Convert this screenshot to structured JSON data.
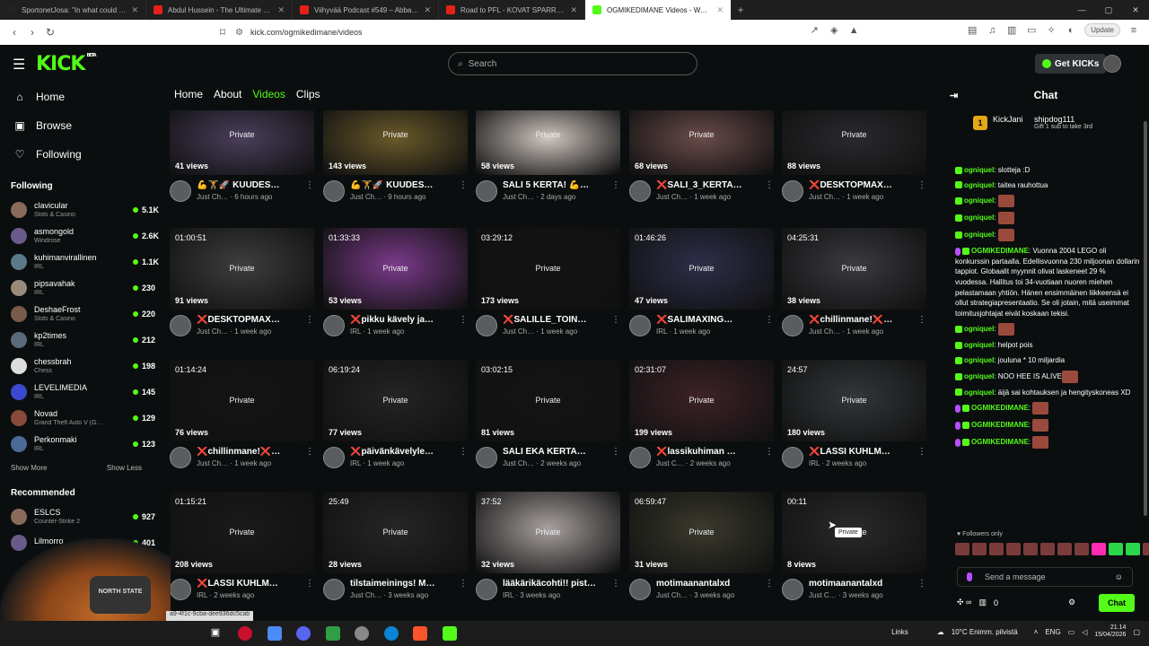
{
  "browser": {
    "tabs": [
      {
        "label": "SportonetJosa: \"In what could be fi…",
        "color": "#222"
      },
      {
        "label": "Abdul Hussein - The Ultimate Fighter",
        "color": "#e62117"
      },
      {
        "label": "Viihyvää Podcast #549 – Abba TUF…",
        "color": "#e62117"
      },
      {
        "label": "Road to PFL - KOVAT SPARRIT - You…",
        "color": "#e62117"
      },
      {
        "label": "OGMIKEDIMANE Videos - Watch…",
        "color": "#53fc18"
      }
    ],
    "url": "kick.com/ogmikedimane/videos",
    "update_label": "Update",
    "new_tab": "+"
  },
  "header": {
    "logo": "KICK",
    "logo_beta": "BETA",
    "search_placeholder": "Search",
    "get_kicks": "Get KICKs"
  },
  "sidebar": {
    "nav": [
      {
        "label": "Home",
        "icon": "home-icon",
        "glyph": "⌂"
      },
      {
        "label": "Browse",
        "icon": "browse-icon",
        "glyph": "▣"
      },
      {
        "label": "Following",
        "icon": "heart-icon",
        "glyph": "♡"
      }
    ],
    "following_title": "Following",
    "following": [
      {
        "name": "clavicular",
        "category": "Slots & Casino",
        "viewers": "5.1K"
      },
      {
        "name": "asmongold",
        "category": "Windrose",
        "viewers": "2.6K"
      },
      {
        "name": "kuhimanvirallinen",
        "category": "IRL",
        "viewers": "1.1K"
      },
      {
        "name": "pipsavahak",
        "category": "IRL",
        "viewers": "230"
      },
      {
        "name": "DeshaeFrost",
        "category": "Slots & Casino",
        "viewers": "220"
      },
      {
        "name": "kp2times",
        "category": "IRL",
        "viewers": "212"
      },
      {
        "name": "chessbrah",
        "category": "Chess",
        "viewers": "198"
      },
      {
        "name": "LEVELIMEDIA",
        "category": "IRL",
        "viewers": "145"
      },
      {
        "name": "Novad",
        "category": "Grand Theft Auto V (G…",
        "viewers": "129"
      },
      {
        "name": "Perkonmaki",
        "category": "IRL",
        "viewers": "123"
      }
    ],
    "show_more": "Show More",
    "show_less": "Show Less",
    "recommended_title": "Recommended",
    "recommended": [
      {
        "name": "ESLCS",
        "category": "Counter-Strike 2",
        "viewers": "927"
      },
      {
        "name": "Lilmorro",
        "category": "",
        "viewers": "401"
      }
    ]
  },
  "main": {
    "tabs": [
      {
        "label": "Home",
        "active": false
      },
      {
        "label": "About",
        "active": false
      },
      {
        "label": "Videos",
        "active": true
      },
      {
        "label": "Clips",
        "active": false
      }
    ],
    "private_label": "Private",
    "videos": [
      {
        "duration": "",
        "views": "41 views",
        "title": "💪🏋️🚀 KUUDES…",
        "sub": "Just Ch… · 6 hours ago",
        "color": "#4a3f5c"
      },
      {
        "duration": "",
        "views": "143 views",
        "title": "💪🏋️🚀 KUUDES…",
        "sub": "Just Ch… · 9 hours ago",
        "color": "#6a5a2a"
      },
      {
        "duration": "",
        "views": "58 views",
        "title": "SALI 5 KERTA! 💪…",
        "sub": "Just Ch… · 2 days ago",
        "color": "#cfc6c0"
      },
      {
        "duration": "",
        "views": "68 views",
        "title": "❌SALI_3_KERTA…",
        "sub": "Just Ch… · 1 week ago",
        "color": "#6b4b4b"
      },
      {
        "duration": "",
        "views": "88 views",
        "title": "❌DESKTOPMAX…",
        "sub": "Just Ch… · 1 week ago",
        "color": "#2a2a2e"
      },
      {
        "duration": "01:00:51",
        "views": "91 views",
        "title": "❌DESKTOPMAX…",
        "sub": "Just Ch… · 1 week ago",
        "color": "#3e3e3e"
      },
      {
        "duration": "01:33:33",
        "views": "53 views",
        "title": "❌pikku kävely ja…",
        "sub": "IRL · 1 week ago",
        "color": "#7a3a8a"
      },
      {
        "duration": "03:29:12",
        "views": "173 views",
        "title": "❌SALILLE_TOIN…",
        "sub": "Just Ch… · 1 week ago",
        "color": "#121212"
      },
      {
        "duration": "01:46:26",
        "views": "47 views",
        "title": "❌SALIMAXING…",
        "sub": "IRL · 1 week ago",
        "color": "#2e2e4a"
      },
      {
        "duration": "04:25:31",
        "views": "38 views",
        "title": "❌chillinmane!❌…",
        "sub": "Just Ch… · 1 week ago",
        "color": "#3a3a40"
      },
      {
        "duration": "01:14:24",
        "views": "76 views",
        "title": "❌chillinmane!❌…",
        "sub": "Just Ch… · 1 week ago",
        "color": "#141414"
      },
      {
        "duration": "06:19:24",
        "views": "77 views",
        "title": "❌päivänkävelyle…",
        "sub": "IRL · 1 week ago",
        "color": "#242424"
      },
      {
        "duration": "03:02:15",
        "views": "81 views",
        "title": "SALI EKA KERTA…",
        "sub": "Just Ch… · 2 weeks ago",
        "color": "#141414"
      },
      {
        "duration": "02:31:07",
        "views": "199 views",
        "title": "❌lassikuhiman …",
        "sub": "Just C… · 2 weeks ago",
        "color": "#3e2228"
      },
      {
        "duration": "24:57",
        "views": "180 views",
        "title": "❌LASSI KUHLM…",
        "sub": "IRL · 2 weeks ago",
        "color": "#33373a"
      },
      {
        "duration": "01:15:21",
        "views": "208 views",
        "title": "❌LASSI KUHLM…",
        "sub": "IRL · 2 weeks ago",
        "color": "#1a1a1a"
      },
      {
        "duration": "25:49",
        "views": "28 views",
        "title": "tilstaimeinings! M…",
        "sub": "Just Ch… · 3 weeks ago",
        "color": "#262626"
      },
      {
        "duration": "37:52",
        "views": "32 views",
        "title": "lääkärikäcohti!! pist…",
        "sub": "IRL · 3 weeks ago",
        "color": "#a8a0a0"
      },
      {
        "duration": "06:59:47",
        "views": "31 views",
        "title": "motimaanantalxd",
        "sub": "Just Ch… · 3 weeks ago",
        "color": "#3a3a2e"
      },
      {
        "duration": "00:11",
        "views": "8 views",
        "title": "motimaanantalxd",
        "sub": "Just C… · 3 weeks ago",
        "color": "#2a2a2a"
      }
    ],
    "tooltip": "Private"
  },
  "chat": {
    "title": "Chat",
    "pinned_user1": "KickJani",
    "pinned_user2": "shipdog111",
    "pinned_medal": "1",
    "pinned_gift": "Gift 1 sub to take 3rd",
    "messages": [
      {
        "user": "ogniquel",
        "text": "slotteja :D",
        "emote": false
      },
      {
        "user": "ogniquel",
        "text": "taitea rauhottua",
        "emote": false
      },
      {
        "user": "ogniquel",
        "text": "",
        "emote": true
      },
      {
        "user": "ogniquel",
        "text": "",
        "emote": true
      },
      {
        "user": "ogniquel",
        "text": "",
        "emote": true
      },
      {
        "user": "OGMIKEDIMANE",
        "text": "Vuonna 2004 LEGO oli konkurssin partaalla. Edellisvuonna 230 miljoonan dollarin tappiot. Globaalit myynnit olivat laskeneet 29 % vuodessa. Hallitus toi 34-vuotiaan nuoren miehen pelastamaan yhtiön. Hänen ensimmäinen liikkeensä ei ollut strategiapresentaatio. Se oli jotain, mitä useimmat toimitusjohtajat eivät koskaan tekisi.",
        "emote": false
      },
      {
        "user": "ogniquel",
        "text": "",
        "emote": true
      },
      {
        "user": "ogniquel",
        "text": "helpot pois",
        "emote": false
      },
      {
        "user": "ogniquel",
        "text": "jouluna * 10 miljardia",
        "emote": false
      },
      {
        "user": "ogniquel",
        "text": "NOO HEE IS ALIVE",
        "emote": true
      },
      {
        "user": "ogniquel",
        "text": "äijä sai kohtauksen ja hengityskoneas XD",
        "emote": false
      },
      {
        "user": "OGMIKEDIMANE",
        "text": "",
        "emote": true
      },
      {
        "user": "OGMIKEDIMANE",
        "text": "",
        "emote": true
      },
      {
        "user": "OGMIKEDIMANE",
        "text": "",
        "emote": true
      }
    ],
    "followers_only": "Followers only",
    "send_placeholder": "Send a message",
    "kicks_count": "0",
    "chat_button": "Chat"
  },
  "taskbar": {
    "links": "Links",
    "weather": "10°C Enimm. pilvistä",
    "lang": "ENG",
    "time": "21.14",
    "date": "15/04/2026"
  },
  "status_url": "a9-4f1c-9cba-dee936dc5cab",
  "webcam_hat": "NORTH STATE"
}
